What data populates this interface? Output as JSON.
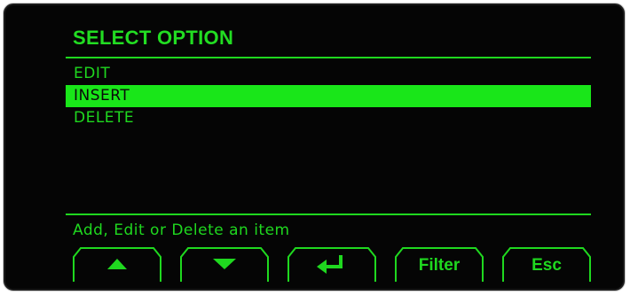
{
  "dialog": {
    "title": "SELECT OPTION",
    "help_text": "Add, Edit or Delete an item"
  },
  "menu": {
    "items": [
      {
        "label": "EDIT",
        "selected": false
      },
      {
        "label": "INSERT",
        "selected": true
      },
      {
        "label": "DELETE",
        "selected": false
      }
    ]
  },
  "softkeys": {
    "up_icon": "triangle-up-icon",
    "down_icon": "triangle-down-icon",
    "enter_icon": "enter-arrow-icon",
    "filter_label": "Filter",
    "esc_label": "Esc"
  },
  "colors": {
    "display_background": "#050505",
    "display_green": "#1fd81f",
    "highlight": "#19e619",
    "highlight_text": "#0a0a0a"
  }
}
